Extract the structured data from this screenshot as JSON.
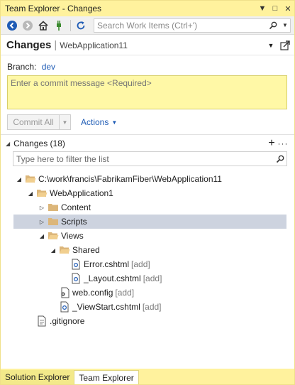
{
  "window": {
    "title": "Team Explorer - Changes",
    "dropdown_glyph": "▼",
    "maximize_glyph": "□",
    "close_glyph": "✕"
  },
  "toolbar": {
    "icons": [
      "back-icon",
      "forward-icon",
      "home-icon",
      "connect-icon",
      "refresh-icon"
    ],
    "search_placeholder": "Search Work Items (Ctrl+')"
  },
  "header": {
    "title": "Changes",
    "separator": "|",
    "subtitle": "WebApplication11"
  },
  "branch": {
    "label": "Branch:",
    "value": "dev"
  },
  "commit": {
    "placeholder": "Enter a commit message <Required>",
    "button_label": "Commit All",
    "actions_label": "Actions"
  },
  "changes": {
    "header_label": "Changes (18)",
    "filter_placeholder": "Type here to filter the list",
    "tree": [
      {
        "label": "C:\\work\\francis\\FabrikamFiber\\WebApplication11",
        "tag": "",
        "depth": 0,
        "arrow": "expanded",
        "icon": "folder-open-icon",
        "selected": false
      },
      {
        "label": "WebApplication1",
        "tag": "",
        "depth": 1,
        "arrow": "expanded",
        "icon": "folder-open-icon",
        "selected": false
      },
      {
        "label": "Content",
        "tag": "",
        "depth": 2,
        "arrow": "collapsed",
        "icon": "folder-icon",
        "selected": false
      },
      {
        "label": "Scripts",
        "tag": "",
        "depth": 2,
        "arrow": "collapsed",
        "icon": "folder-icon",
        "selected": true
      },
      {
        "label": "Views",
        "tag": "",
        "depth": 2,
        "arrow": "expanded",
        "icon": "folder-open-icon",
        "selected": false
      },
      {
        "label": "Shared",
        "tag": "",
        "depth": 3,
        "arrow": "expanded",
        "icon": "folder-open-icon",
        "selected": false
      },
      {
        "label": "Error.cshtml",
        "tag": "[add]",
        "depth": 4,
        "arrow": "none",
        "icon": "razor-file-icon",
        "selected": false
      },
      {
        "label": "_Layout.cshtml",
        "tag": "[add]",
        "depth": 4,
        "arrow": "none",
        "icon": "razor-file-icon",
        "selected": false
      },
      {
        "label": "web.config",
        "tag": "[add]",
        "depth": 3,
        "arrow": "none",
        "icon": "config-file-icon",
        "selected": false
      },
      {
        "label": "_ViewStart.cshtml",
        "tag": "[add]",
        "depth": 3,
        "arrow": "none",
        "icon": "razor-file-icon",
        "selected": false
      },
      {
        "label": ".gitignore",
        "tag": "",
        "depth": 1,
        "arrow": "none",
        "icon": "text-file-icon",
        "selected": false
      }
    ]
  },
  "bottom_tabs": [
    {
      "label": "Solution Explorer",
      "active": false
    },
    {
      "label": "Team Explorer",
      "active": true
    }
  ],
  "colors": {
    "accent": "#fff29d",
    "link": "#1e5bb5",
    "commit_bg": "#fff8a6",
    "selection": "#cdd3df",
    "folder": "#dcb67a"
  }
}
